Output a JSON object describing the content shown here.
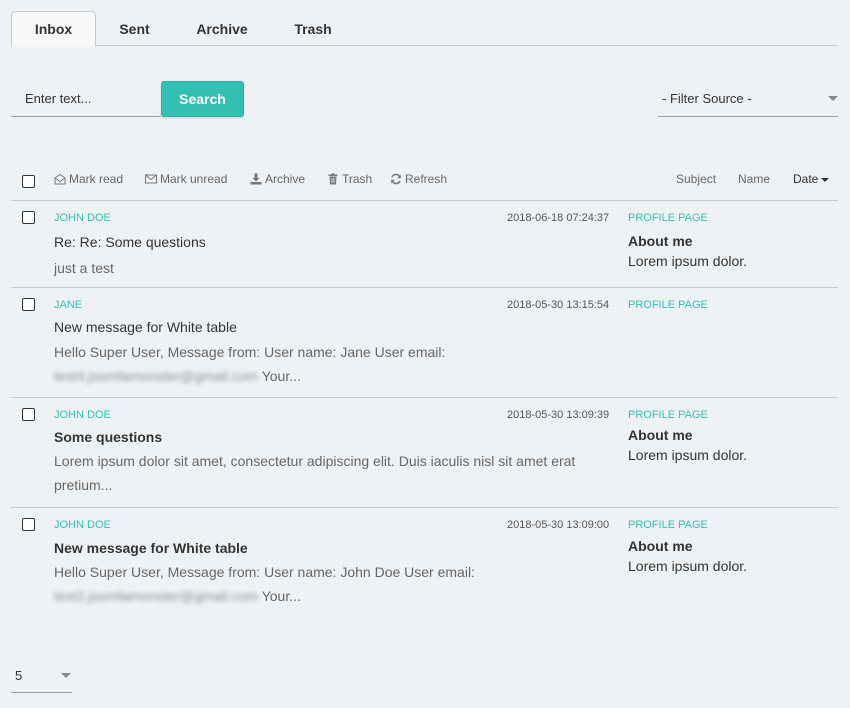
{
  "tabs": [
    {
      "label": "Inbox",
      "active": true
    },
    {
      "label": "Sent",
      "active": false
    },
    {
      "label": "Archive",
      "active": false
    },
    {
      "label": "Trash",
      "active": false
    }
  ],
  "search": {
    "placeholder": "Enter text...",
    "button_label": "Search"
  },
  "filter": {
    "selected": "- Filter Source -"
  },
  "toolbar": {
    "mark_read": "Mark read",
    "mark_unread": "Mark unread",
    "archive": "Archive",
    "trash": "Trash",
    "refresh": "Refresh",
    "sort_subject": "Subject",
    "sort_name": "Name",
    "sort_date": "Date"
  },
  "colors": {
    "accent": "#34bfb2",
    "background": "#eff2f5"
  },
  "messages": [
    {
      "sender": "JOHN DOE",
      "date": "2018-06-18 07:24:37",
      "subject": "Re: Re: Some questions",
      "subject_bold": false,
      "preview": "just a test",
      "preview_email": "",
      "preview_tail": "",
      "source_label": "PROFILE PAGE",
      "source_title": "About me",
      "source_text": "Lorem ipsum dolor."
    },
    {
      "sender": "JANE",
      "date": "2018-05-30 13:15:54",
      "subject": "New message for White table",
      "subject_bold": false,
      "preview": "Hello Super User, Message from: User name: Jane User email:",
      "preview_email": "test4.joomlamonster@gmail.com",
      "preview_tail": "Your...",
      "source_label": "PROFILE PAGE",
      "source_title": "",
      "source_text": ""
    },
    {
      "sender": "JOHN DOE",
      "date": "2018-05-30 13:09:39",
      "subject": "Some questions",
      "subject_bold": true,
      "preview": "Lorem ipsum dolor sit amet, consectetur adipiscing elit. Duis iaculis nisl sit amet erat pretium...",
      "preview_email": "",
      "preview_tail": "",
      "source_label": "PROFILE PAGE",
      "source_title": "About me",
      "source_text": "Lorem ipsum dolor."
    },
    {
      "sender": "JOHN DOE",
      "date": "2018-05-30 13:09:00",
      "subject": "New message for White table",
      "subject_bold": true,
      "preview": "Hello Super User, Message from: User name: John Doe User email:",
      "preview_email": "test2.joomlamonster@gmail.com",
      "preview_tail": "Your...",
      "source_label": "PROFILE PAGE",
      "source_title": "About me",
      "source_text": "Lorem ipsum dolor."
    }
  ],
  "pagination": {
    "per_page": "5"
  }
}
